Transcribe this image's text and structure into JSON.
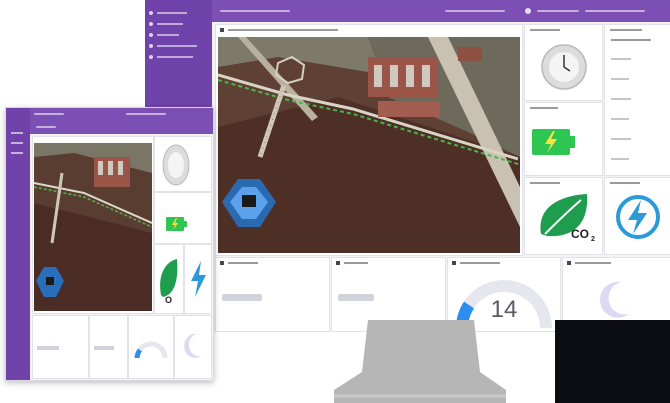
{
  "gauge": {
    "value": "14"
  },
  "colors": {
    "accent": "#7c4fb4",
    "battery": "#2dc653",
    "leaf": "#1f9d4e",
    "bolt": "#2a9bd8",
    "map_marker": "#2d8ef0"
  },
  "icons": [
    "map-icon",
    "clock-icon",
    "battery-icon",
    "leaf-icon",
    "lightning-icon",
    "moon-icon"
  ]
}
